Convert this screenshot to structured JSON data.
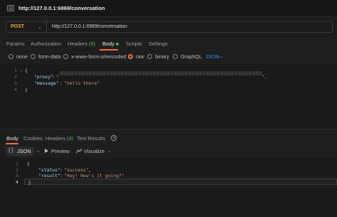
{
  "window": {
    "title": "http://127.0.0.1:6969/conversation"
  },
  "request": {
    "method": "POST",
    "url": "http://127.0.0.1:6969/conversation",
    "tabs": [
      {
        "label": "Params"
      },
      {
        "label": "Authorization"
      },
      {
        "label": "Headers",
        "count": "(8)"
      },
      {
        "label": "Body",
        "active": true
      },
      {
        "label": "Scripts"
      },
      {
        "label": "Settings"
      }
    ],
    "body_types": [
      "none",
      "form-data",
      "x-www-form-urlencoded",
      "raw",
      "binary",
      "GraphQL"
    ],
    "body_selected": "raw",
    "language": "JSON",
    "code": {
      "line_numbers": [
        "1",
        "2",
        "3",
        "4"
      ],
      "open_brace": "{",
      "proxy_key": "\"proxy\"",
      "proxy_value_start": "\"",
      "proxy_value_end": "\",",
      "message_key": "\"message\"",
      "message_value": "\"hello there\"",
      "close_brace": "}"
    }
  },
  "response": {
    "tabs": [
      {
        "label": "Body",
        "active": true
      },
      {
        "label": "Cookies"
      },
      {
        "label": "Headers",
        "count": "(4)"
      },
      {
        "label": "Test Results"
      }
    ],
    "toolbar": {
      "format_label": "JSON",
      "preview_label": "Preview",
      "visualize_label": "Visualize"
    },
    "code": {
      "line_numbers": [
        "1",
        "2",
        "3",
        "4"
      ],
      "open_brace": "{",
      "status_key": "\"status\"",
      "status_value": "\"success\"",
      "result_key": "\"result\"",
      "result_value": "\"Hey! How's it going?\"",
      "close_brace": "}"
    }
  },
  "colors": {
    "accent": "#ff6c37",
    "method": "#f2b134",
    "count": "#3fb950",
    "link": "#1e90ff"
  },
  "icons": [
    "request-tab-icon",
    "chevron-down-icon",
    "history-icon",
    "braces-icon",
    "play-icon",
    "chart-icon"
  ]
}
